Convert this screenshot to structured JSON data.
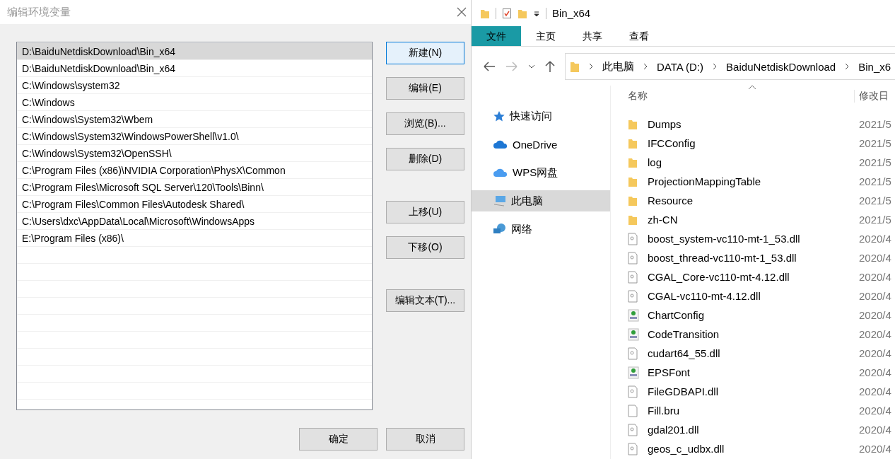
{
  "dialog": {
    "title": "编辑环境变量",
    "paths": [
      {
        "text": "D:\\BaiduNetdiskDownload\\Bin_x64",
        "selected": true
      },
      {
        "text": "D:\\BaiduNetdiskDownload\\Bin_x64",
        "selected": false
      },
      {
        "text": "C:\\Windows\\system32",
        "selected": false
      },
      {
        "text": "C:\\Windows",
        "selected": false
      },
      {
        "text": "C:\\Windows\\System32\\Wbem",
        "selected": false
      },
      {
        "text": "C:\\Windows\\System32\\WindowsPowerShell\\v1.0\\",
        "selected": false
      },
      {
        "text": "C:\\Windows\\System32\\OpenSSH\\",
        "selected": false
      },
      {
        "text": "C:\\Program Files (x86)\\NVIDIA Corporation\\PhysX\\Common",
        "selected": false
      },
      {
        "text": "C:\\Program Files\\Microsoft SQL Server\\120\\Tools\\Binn\\",
        "selected": false
      },
      {
        "text": "C:\\Program Files\\Common Files\\Autodesk Shared\\",
        "selected": false
      },
      {
        "text": "C:\\Users\\dxc\\AppData\\Local\\Microsoft\\WindowsApps",
        "selected": false
      },
      {
        "text": "E:\\Program Files (x86)\\",
        "selected": false
      }
    ],
    "side_button_groups": [
      [
        {
          "label": "新建(N)",
          "focused": true
        },
        {
          "label": "编辑(E)",
          "focused": false
        },
        {
          "label": "浏览(B)...",
          "focused": false
        },
        {
          "label": "删除(D)",
          "focused": false
        }
      ],
      [
        {
          "label": "上移(U)",
          "focused": false
        },
        {
          "label": "下移(O)",
          "focused": false
        }
      ],
      [
        {
          "label": "编辑文本(T)...",
          "focused": false
        }
      ]
    ],
    "buttons": [
      "确定",
      "取消"
    ]
  },
  "explorer": {
    "title": "Bin_x64",
    "tabs": [
      {
        "label": "文件",
        "selected": true
      },
      {
        "label": "主页",
        "selected": false
      },
      {
        "label": "共享",
        "selected": false
      },
      {
        "label": "查看",
        "selected": false
      }
    ],
    "breadcrumb": [
      "此电脑",
      "DATA (D:)",
      "BaiduNetdiskDownload",
      "Bin_x6"
    ],
    "nav": [
      {
        "label": "快速访问",
        "kind": "star",
        "selected": false
      },
      {
        "label": "OneDrive",
        "kind": "cloud",
        "selected": false
      },
      {
        "label": "WPS网盘",
        "kind": "wps",
        "selected": false
      },
      {
        "label": "此电脑",
        "kind": "pc",
        "selected": true
      },
      {
        "label": "网络",
        "kind": "network",
        "selected": false
      }
    ],
    "columns": [
      "名称",
      "修改日"
    ],
    "files": [
      {
        "name": "Dumps",
        "kind": "folder",
        "date": "2021/5"
      },
      {
        "name": "IFCConfig",
        "kind": "folder",
        "date": "2021/5"
      },
      {
        "name": "log",
        "kind": "folder",
        "date": "2021/5"
      },
      {
        "name": "ProjectionMappingTable",
        "kind": "folder",
        "date": "2021/5"
      },
      {
        "name": "Resource",
        "kind": "folder",
        "date": "2021/5"
      },
      {
        "name": "zh-CN",
        "kind": "folder",
        "date": "2021/5"
      },
      {
        "name": "boost_system-vc110-mt-1_53.dll",
        "kind": "dll",
        "date": "2020/4"
      },
      {
        "name": "boost_thread-vc110-mt-1_53.dll",
        "kind": "dll",
        "date": "2020/4"
      },
      {
        "name": "CGAL_Core-vc110-mt-4.12.dll",
        "kind": "dll",
        "date": "2020/4"
      },
      {
        "name": "CGAL-vc110-mt-4.12.dll",
        "kind": "dll",
        "date": "2020/4"
      },
      {
        "name": "ChartConfig",
        "kind": "config",
        "date": "2020/4"
      },
      {
        "name": "CodeTransition",
        "kind": "config",
        "date": "2020/4"
      },
      {
        "name": "cudart64_55.dll",
        "kind": "dll",
        "date": "2020/4"
      },
      {
        "name": "EPSFont",
        "kind": "config",
        "date": "2020/4"
      },
      {
        "name": "FileGDBAPI.dll",
        "kind": "dll",
        "date": "2020/4"
      },
      {
        "name": "Fill.bru",
        "kind": "blank",
        "date": "2020/4"
      },
      {
        "name": "gdal201.dll",
        "kind": "dll",
        "date": "2020/4"
      },
      {
        "name": "geos_c_udbx.dll",
        "kind": "dll",
        "date": "2020/4"
      }
    ]
  }
}
